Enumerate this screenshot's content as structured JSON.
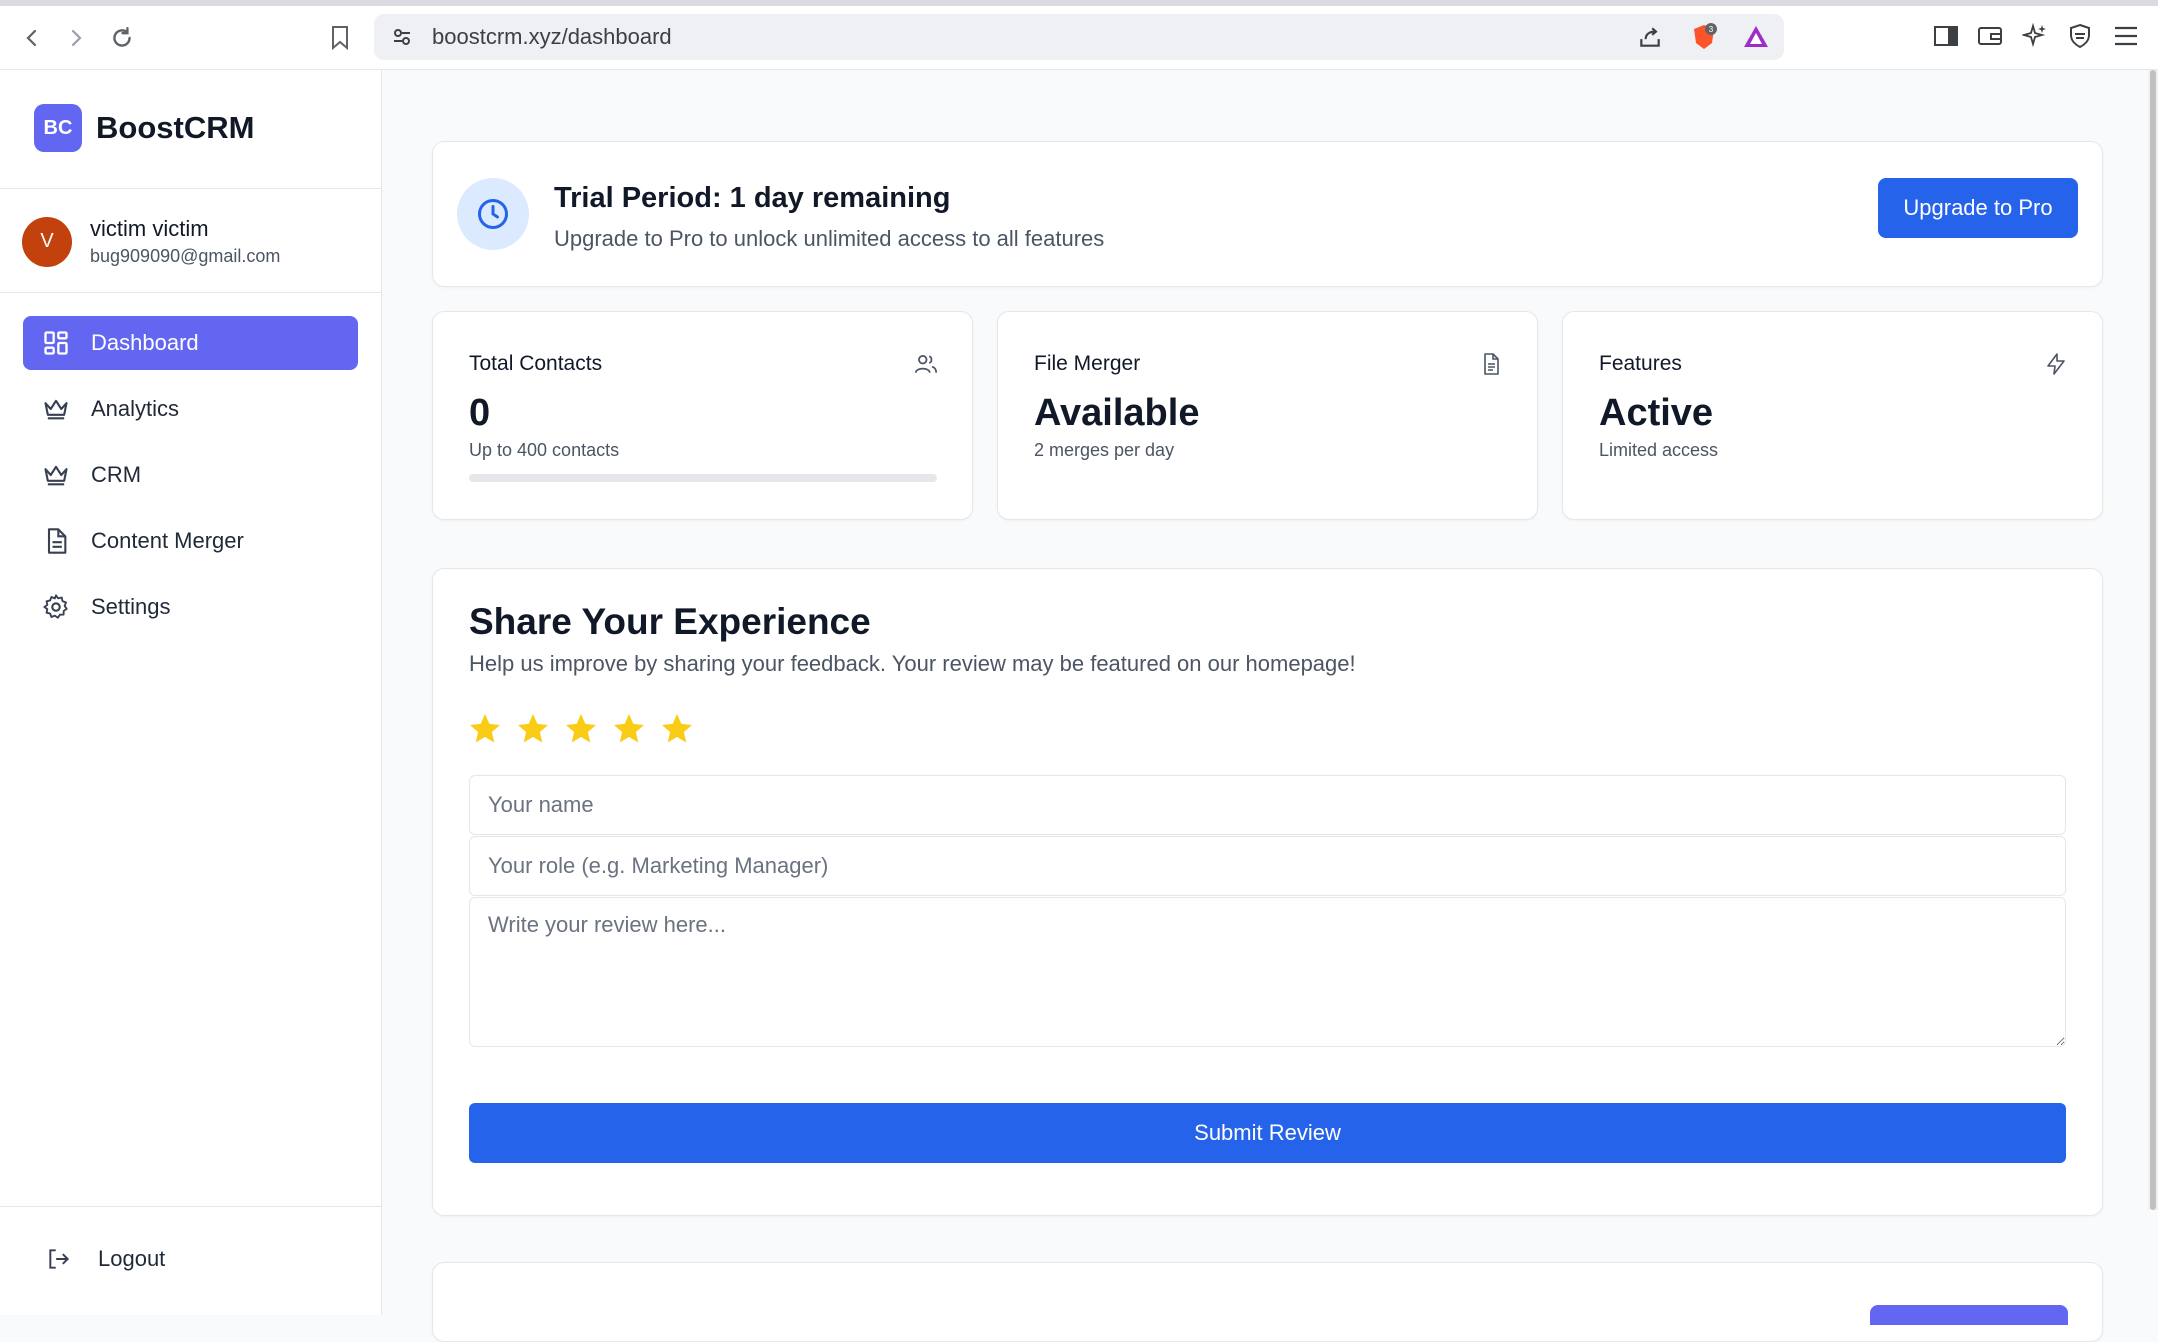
{
  "browser": {
    "url": "boostcrm.xyz/dashboard",
    "shields_count": "3"
  },
  "brand": {
    "logo_text": "BC",
    "name": "BoostCRM"
  },
  "user": {
    "initial": "V",
    "name": "victim victim",
    "email": "bug909090@gmail.com"
  },
  "sidebar": {
    "items": [
      {
        "label": "Dashboard",
        "icon": "dashboard-grid-icon",
        "active": true
      },
      {
        "label": "Analytics",
        "icon": "crown-icon"
      },
      {
        "label": "CRM",
        "icon": "crown-icon"
      },
      {
        "label": "Content Merger",
        "icon": "document-icon"
      },
      {
        "label": "Settings",
        "icon": "gear-icon"
      }
    ],
    "logout_label": "Logout"
  },
  "trial": {
    "title": "Trial Period: 1 day remaining",
    "subtitle": "Upgrade to Pro to unlock unlimited access to all features",
    "upgrade_label": "Upgrade to Pro"
  },
  "stats": [
    {
      "label": "Total Contacts",
      "value": "0",
      "sub": "Up to 400 contacts",
      "icon": "users-icon",
      "progress": 0
    },
    {
      "label": "File Merger",
      "value": "Available",
      "sub": "2 merges per day",
      "icon": "file-icon"
    },
    {
      "label": "Features",
      "value": "Active",
      "sub": "Limited access",
      "icon": "bolt-icon"
    }
  ],
  "review": {
    "title": "Share Your Experience",
    "subtitle": "Help us improve by sharing your feedback. Your review may be featured on our homepage!",
    "rating": 5,
    "name_placeholder": "Your name",
    "role_placeholder": "Your role (e.g. Marketing Manager)",
    "review_placeholder": "Write your review here...",
    "submit_label": "Submit Review"
  },
  "colors": {
    "primary": "#2563eb",
    "accent": "#6366f1",
    "star": "#facc15",
    "avatar": "#c2410c"
  }
}
